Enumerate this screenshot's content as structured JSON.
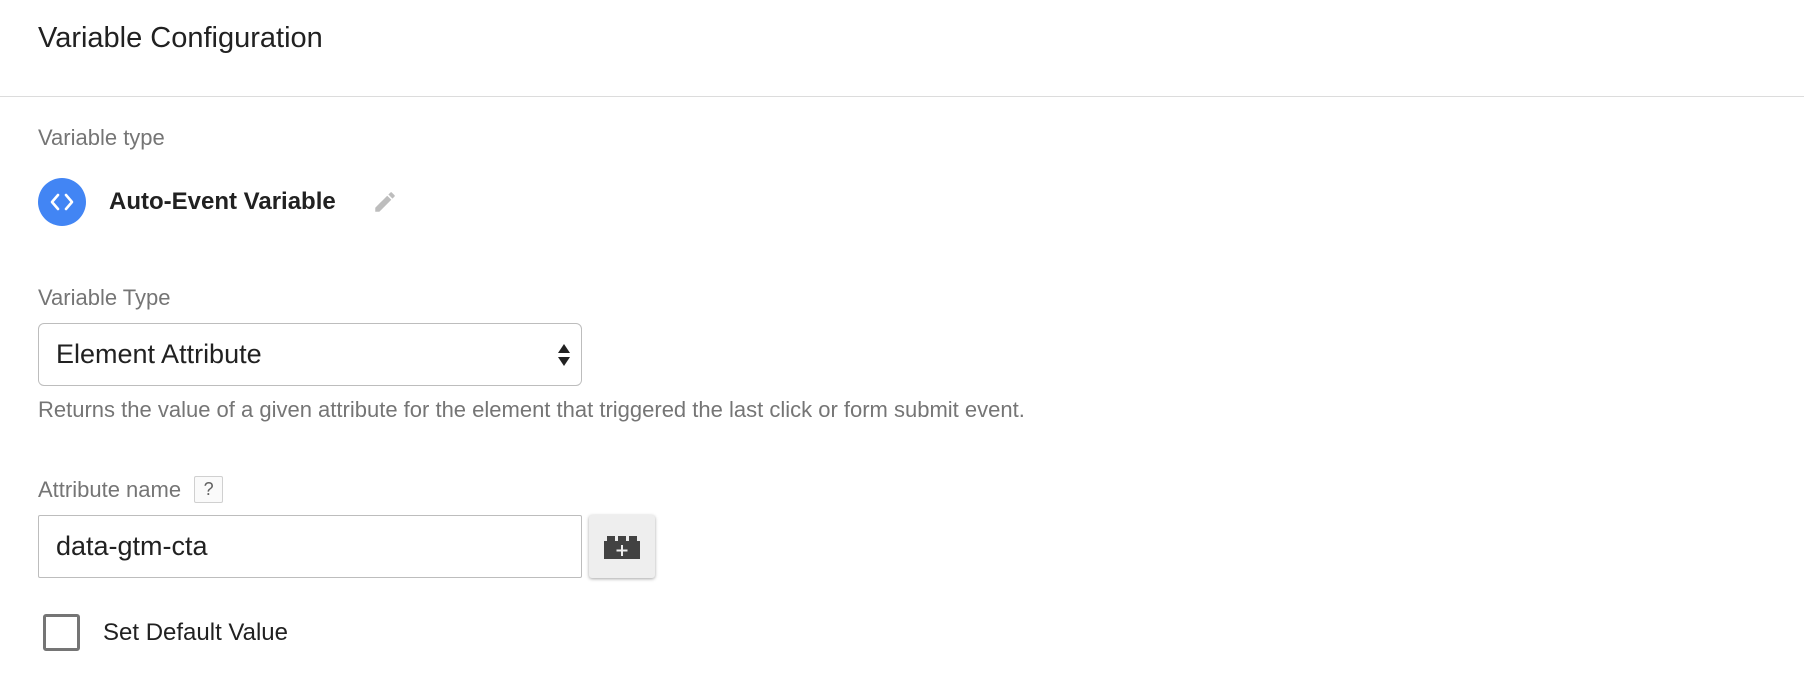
{
  "header": {
    "title": "Variable Configuration"
  },
  "variable_type_section": {
    "label": "Variable type",
    "type_name": "Auto-Event Variable",
    "type_icon": "code-brackets-icon",
    "type_icon_color": "#4285f4",
    "edit_icon": "pencil-icon"
  },
  "variable_type_select": {
    "label": "Variable Type",
    "selected_value": "Element Attribute",
    "helper_text": "Returns the value of a given attribute for the element that triggered the last click or form submit event."
  },
  "attribute_name": {
    "label": "Attribute name",
    "help_symbol": "?",
    "value": "data-gtm-cta",
    "variable_button_icon": "lego-brick-add-icon"
  },
  "default_value": {
    "label": "Set Default Value",
    "checked": false
  }
}
